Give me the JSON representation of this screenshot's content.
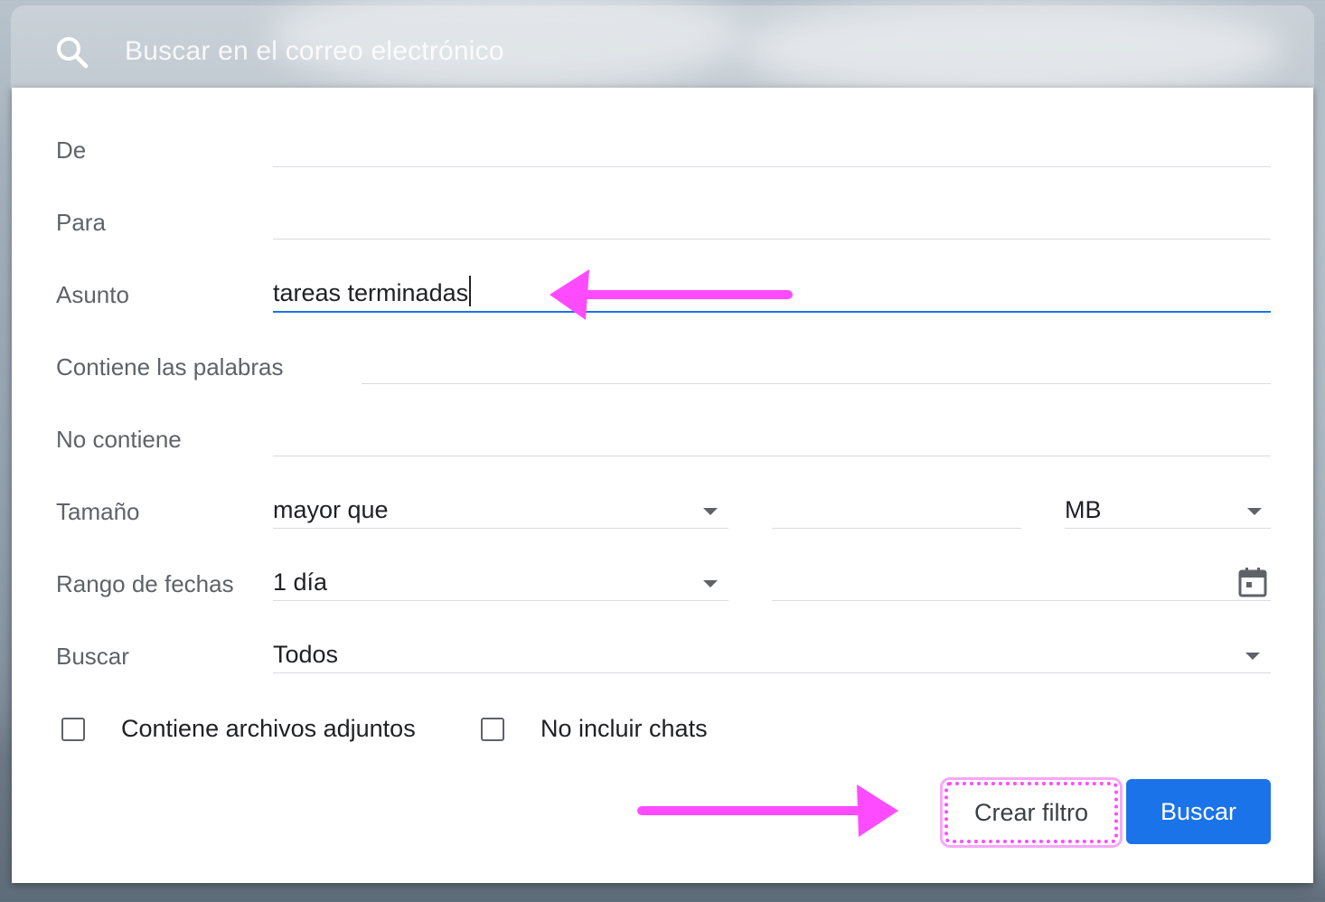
{
  "search": {
    "placeholder": "Buscar en el correo electrónico"
  },
  "form": {
    "from": {
      "label": "De",
      "value": ""
    },
    "to": {
      "label": "Para",
      "value": ""
    },
    "subject": {
      "label": "Asunto",
      "value": "tareas terminadas"
    },
    "has_words": {
      "label": "Contiene las palabras",
      "value": ""
    },
    "doesnt_have": {
      "label": "No contiene",
      "value": ""
    },
    "size": {
      "label": "Tamaño",
      "operator": "mayor que",
      "value": "",
      "unit": "MB"
    },
    "date_range": {
      "label": "Rango de fechas",
      "value": "1 día",
      "date": ""
    },
    "search_in": {
      "label": "Buscar",
      "value": "Todos"
    },
    "has_attachment": {
      "label": "Contiene archivos adjuntos",
      "checked": false
    },
    "exclude_chats": {
      "label": "No incluir chats",
      "checked": false
    }
  },
  "actions": {
    "create_filter": "Crear filtro",
    "search": "Buscar"
  },
  "colors": {
    "accent": "#1a73e8",
    "annotation": "#ff4bff"
  }
}
